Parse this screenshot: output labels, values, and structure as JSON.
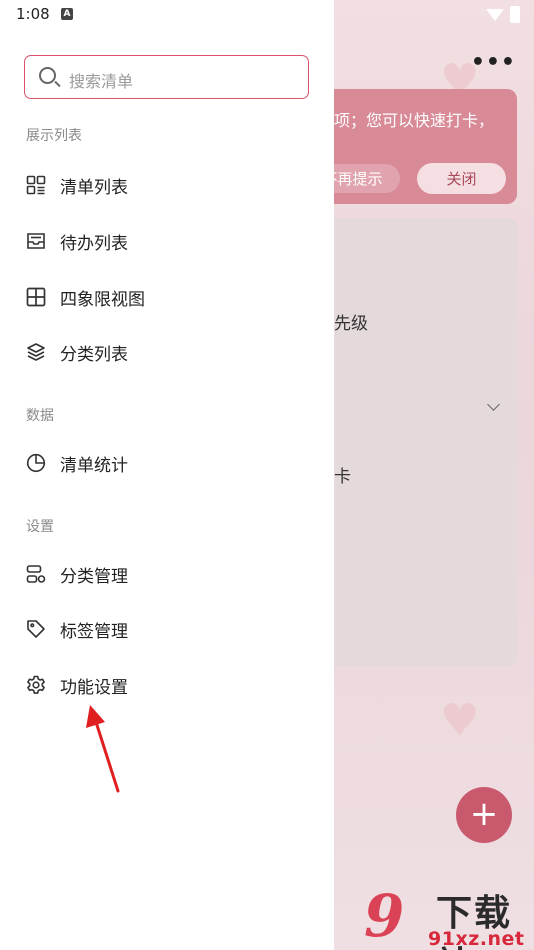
{
  "status_bar": {
    "time": "1:08",
    "notif_glyph": "A"
  },
  "search": {
    "placeholder": "搜索清单"
  },
  "sections": [
    {
      "title": "展示列表",
      "items": [
        {
          "label": "清单列表",
          "icon": "grid-list-icon"
        },
        {
          "label": "待办列表",
          "icon": "inbox-icon"
        },
        {
          "label": "四象限视图",
          "icon": "quadrant-icon"
        },
        {
          "label": "分类列表",
          "icon": "layers-icon"
        }
      ]
    },
    {
      "title": "数据",
      "items": [
        {
          "label": "清单统计",
          "icon": "pie-chart-icon"
        }
      ]
    },
    {
      "title": "设置",
      "items": [
        {
          "label": "分类管理",
          "icon": "category-manage-icon"
        },
        {
          "label": "标签管理",
          "icon": "tag-icon"
        },
        {
          "label": "功能设置",
          "icon": "gear-icon"
        }
      ]
    }
  ],
  "background": {
    "banner_text": "事项；您可以快速打卡，",
    "banner_dismiss": "不再提示",
    "banner_close": "关闭",
    "text_priority": "先级",
    "text_checkin": "卡",
    "fab_symbol": "+"
  },
  "watermark": {
    "big": "9",
    "text": "下载站",
    "url": "91xz.net"
  },
  "colors": {
    "accent": "#d9536a",
    "fab": "#c95a6e",
    "arrow": "#e02020"
  }
}
